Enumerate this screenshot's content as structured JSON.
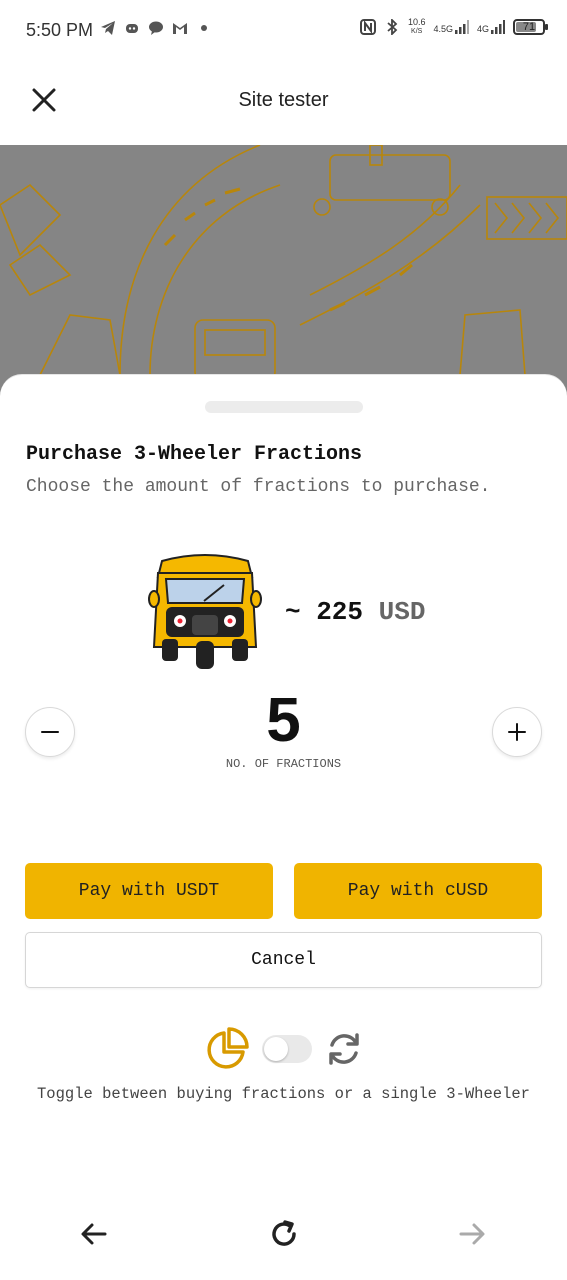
{
  "status_bar": {
    "time": "5:50 PM",
    "net_speed_value": "10.6",
    "net_speed_unit": "K/S",
    "network_1": "4.5G",
    "network_2": "4G",
    "battery": "71"
  },
  "header": {
    "title": "Site tester"
  },
  "sheet": {
    "title": "Purchase 3-Wheeler Fractions",
    "subtitle": "Choose the amount of fractions to purchase.",
    "price_prefix": "~ 225",
    "price_currency": "USD",
    "quantity": "5",
    "quantity_label": "NO. OF FRACTIONS",
    "pay_usdt_label": "Pay with USDT",
    "pay_cusd_label": "Pay with cUSD",
    "cancel_label": "Cancel",
    "toggle_caption": "Toggle between buying fractions or a single 3-Wheeler",
    "toggle_on": false
  },
  "colors": {
    "accent": "#f0b400",
    "backdrop": "#858585",
    "icon_gold": "#d89a00"
  },
  "icons": {
    "close": "close-icon",
    "minus": "minus-icon",
    "plus": "plus-icon",
    "fractions": "pie-chart-icon",
    "single": "cycle-icon",
    "back": "arrow-left-icon",
    "reload": "reload-icon",
    "forward": "arrow-right-icon"
  }
}
